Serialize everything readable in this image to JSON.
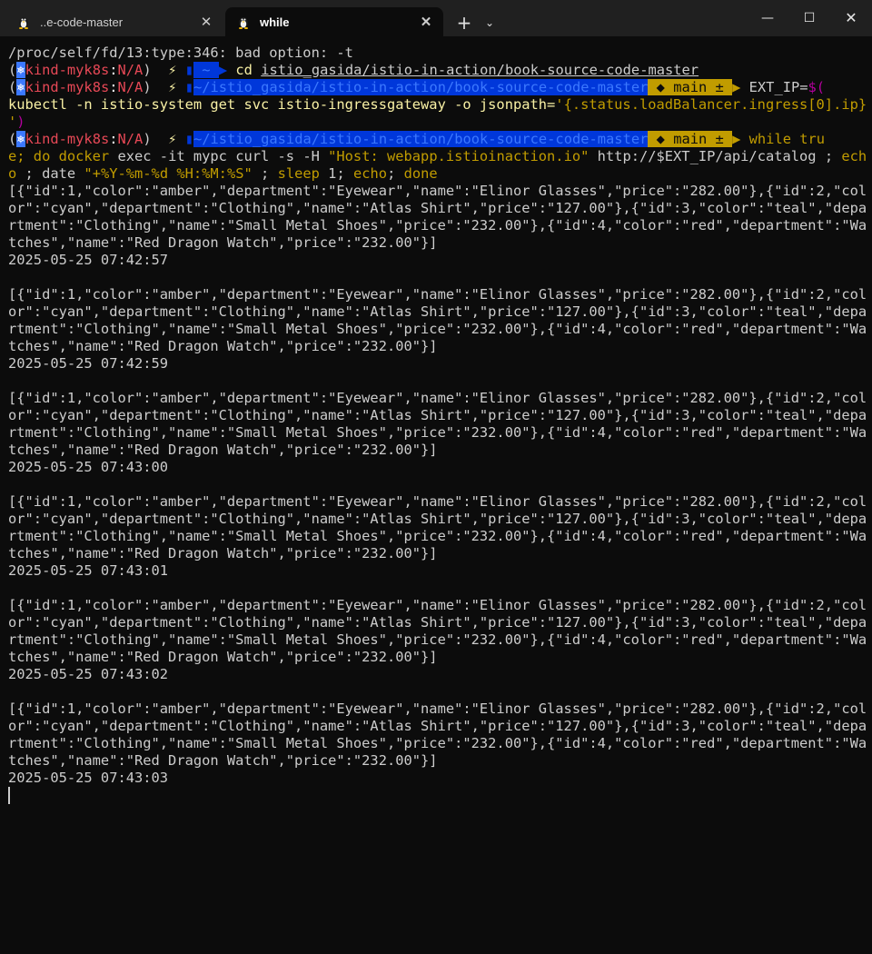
{
  "tabs": [
    {
      "title": "..e-code-master",
      "active": false
    },
    {
      "title": "while",
      "active": true
    }
  ],
  "controls": {
    "new_tab": "+",
    "dropdown": "⌄",
    "minimize": "—",
    "maximize": "☐",
    "close": "✕",
    "tab_close": "✕"
  },
  "terminal": {
    "error_line": "/proc/self/fd/13:type:346: bad option: -t",
    "prompt": {
      "open": "(",
      "k8s_icon": "⎈",
      "context": "kind-myk8s",
      "sep": ":",
      "namespace": "N/A",
      "close": ")",
      "bolt": "⚡",
      "home": "~",
      "path": "~/istio_gasida/istio-in-action/book-source-code-master",
      "git_branch": "◆ main ±"
    },
    "cmd1": {
      "cd": "cd",
      "arg": "istio_gasida/istio-in-action/book-source-code-master"
    },
    "cmd2": {
      "a": "EXT_IP=",
      "b": "$(",
      "c": "kubectl -n istio-system get svc istio-ingressgateway -o jsonpath=",
      "d": "'{.status.loadBalancer.ingress[0].ip}",
      "e": "'",
      "f": ")"
    },
    "cmd3": {
      "a": "while tru",
      "b": "e; do docker",
      "c": " exec -it mypc curl -s -H ",
      "d": "\"Host: webapp.istioinaction.io\"",
      "e": " http://$EXT_IP/api/catalog ; ",
      "f": "ech",
      "g": "o",
      "h": " ; date ",
      "i": "\"+%Y-%m-%d %H:%M:%S\"",
      "j": " ; ",
      "k": "sleep",
      "l": " 1; ",
      "m": "echo",
      "n": "; ",
      "o": "done"
    },
    "output": {
      "l1": "[{\"id\":1,\"color\":\"amber\",\"department\":\"Eyewear\",\"name\":\"Elinor Glasses\",\"price\":\"282.00\"},{\"id\":2,\"col",
      "l2": "or\":\"cyan\",\"department\":\"Clothing\",\"name\":\"Atlas Shirt\",\"price\":\"127.00\"},{\"id\":3,\"color\":\"teal\",\"depa",
      "l3": "rtment\":\"Clothing\",\"name\":\"Small Metal Shoes\",\"price\":\"232.00\"},{\"id\":4,\"color\":\"red\",\"department\":\"Wa",
      "l4": "tches\",\"name\":\"Red Dragon Watch\",\"price\":\"232.00\"}]"
    },
    "timestamps": [
      "2025-05-25 07:42:57",
      "2025-05-25 07:42:59",
      "2025-05-25 07:43:00",
      "2025-05-25 07:43:01",
      "2025-05-25 07:43:02",
      "2025-05-25 07:43:03"
    ]
  }
}
